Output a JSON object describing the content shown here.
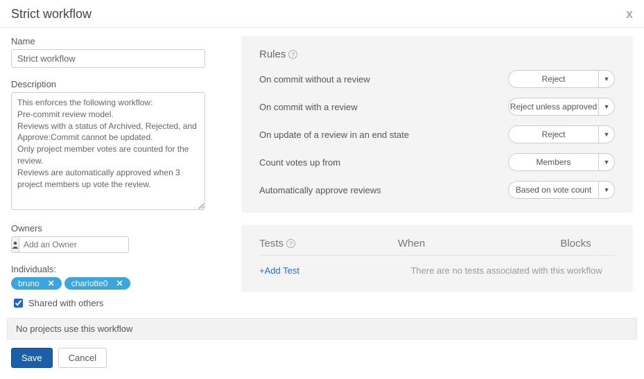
{
  "header": {
    "title": "Strict workflow"
  },
  "form": {
    "name_label": "Name",
    "name_value": "Strict workflow",
    "description_label": "Description",
    "description_value": "This enforces the following workflow:\nPre-commit review model.\nReviews with a status of Archived, Rejected, and Approve:Commit cannot be updated.\nOnly project member votes are counted for the review.\nReviews are automatically approved when 3 project members up vote the review.",
    "owners_label": "Owners",
    "owners_placeholder": "Add an Owner",
    "individuals_label": "Individuals:",
    "individuals": [
      "bruno",
      "charlotte0"
    ],
    "shared_label": "Shared with others",
    "shared_checked": true
  },
  "rules": {
    "title": "Rules",
    "rows": [
      {
        "label": "On commit without a review",
        "value": "Reject"
      },
      {
        "label": "On commit with a review",
        "value": "Reject unless approved"
      },
      {
        "label": "On update of a review in an end state",
        "value": "Reject"
      },
      {
        "label": "Count votes up from",
        "value": "Members"
      },
      {
        "label": "Automatically approve reviews",
        "value": "Based on vote count"
      }
    ]
  },
  "tests": {
    "title": "Tests",
    "col_when": "When",
    "col_blocks": "Blocks",
    "add_label": "+Add Test",
    "empty": "There are no tests associated with this workflow"
  },
  "status": "No projects use this workflow",
  "buttons": {
    "save": "Save",
    "cancel": "Cancel"
  }
}
